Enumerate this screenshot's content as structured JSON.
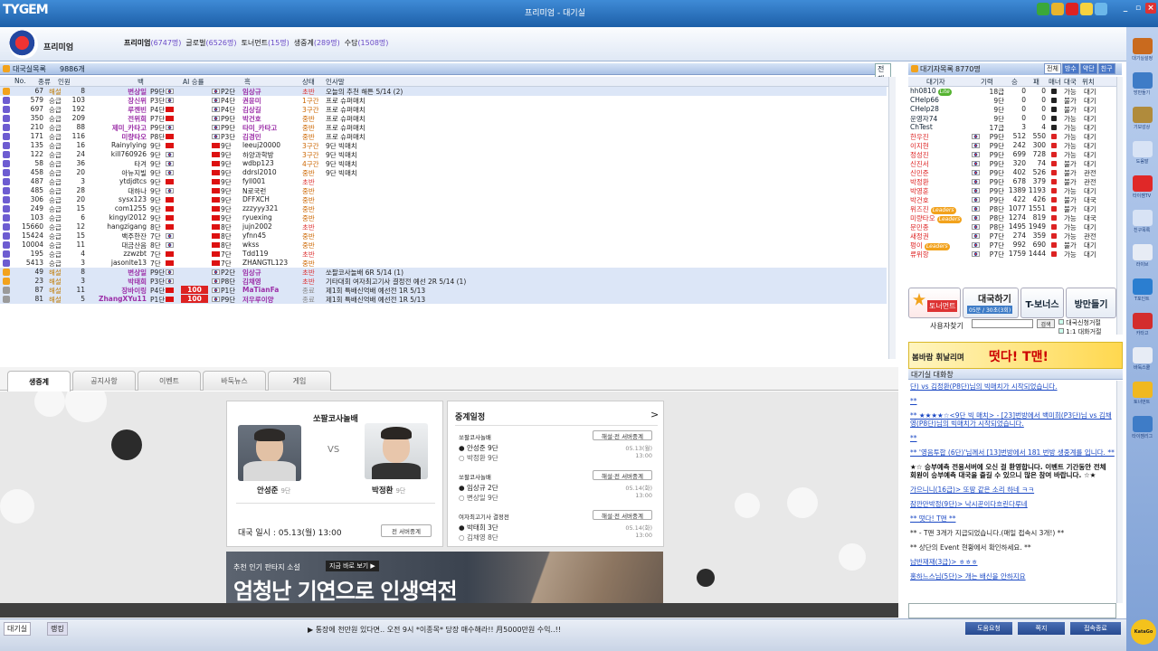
{
  "app": {
    "logo": "TYGEM",
    "center_title": "프리미엄 - 대기실",
    "win_controls": [
      "_",
      "▫",
      "×"
    ]
  },
  "right_bar": [
    {
      "label": "대기실설정",
      "color": "#c96a1e"
    },
    {
      "label": "방만들기",
      "color": "#3e7cc7"
    },
    {
      "label": "기보감상",
      "color": "#b08b3c"
    },
    {
      "label": "도움말",
      "color": "#d8e3f5"
    },
    {
      "label": "타이젬TV",
      "color": "#e02828"
    },
    {
      "label": "친구목록",
      "color": "#d8e3f5"
    },
    {
      "label": "라이브",
      "color": "#e7ecf5"
    },
    {
      "label": "T포인트",
      "color": "#2b7ed0"
    },
    {
      "label": "카타고",
      "color": "#d32d2d"
    },
    {
      "label": "바둑스쿨",
      "color": "#e7ecf5"
    },
    {
      "label": "토너먼트",
      "color": "#f0b820"
    },
    {
      "label": "타이젬리그",
      "color": "#3e7cc7"
    }
  ],
  "room_header": {
    "title": "프리미엄",
    "tabs_text": "프리미엄",
    "tabs": [
      {
        "name": "프리미엄",
        "count": "(6747명)"
      },
      {
        "name": "글로벌",
        "count": "(6526명)"
      },
      {
        "name": "토너먼트",
        "count": "(15명)"
      },
      {
        "name": "생중계",
        "count": "(289명)"
      },
      {
        "name": "수담",
        "count": "(1508명)"
      }
    ]
  },
  "room_list": {
    "title": "대국실목록",
    "count": "9886개",
    "filter": "전체",
    "columns": [
      "No.",
      "종류",
      "인원",
      "백",
      "AI 승률",
      "흑",
      "상태",
      "인사말"
    ],
    "rows": [
      {
        "icon": "y",
        "no": "67",
        "type": "해설",
        "people": "8",
        "white": "변상일",
        "wrank": "P9단",
        "wf": "k",
        "ai": "",
        "brank": "P2단",
        "black": "임상규",
        "state": "초반",
        "msg": "오늘의 추천 해튼 5/14 (2)",
        "sel": true
      },
      {
        "icon": "p",
        "no": "579",
        "type": "승급",
        "people": "103",
        "white": "장신위",
        "wrank": "P3단",
        "wf": "k",
        "ai": "",
        "brank": "P4단",
        "black": "권윤미",
        "state": "1구간",
        "msg": "프로 슈퍼매치",
        "sel": false
      },
      {
        "icon": "p",
        "no": "697",
        "type": "승급",
        "people": "192",
        "white": "루젠빈",
        "wrank": "P4단",
        "wf": "c",
        "ai": "",
        "brank": "P4단",
        "black": "김상길",
        "state": "3구간",
        "msg": "프로 슈퍼매치",
        "sel": false
      },
      {
        "icon": "p",
        "no": "350",
        "type": "승급",
        "people": "209",
        "white": "전위희",
        "wrank": "P7단",
        "wf": "c",
        "ai": "",
        "brank": "P9단",
        "black": "박건호",
        "state": "중반",
        "msg": "프로 슈퍼매치",
        "sel": false
      },
      {
        "icon": "p",
        "no": "210",
        "type": "승급",
        "people": "88",
        "white": "제미_카타고",
        "wrank": "P9단",
        "wf": "k",
        "ai": "",
        "brank": "P9단",
        "black": "타미_카타고",
        "state": "중반",
        "msg": "프로 슈퍼매치",
        "sel": false
      },
      {
        "icon": "p",
        "no": "171",
        "type": "승급",
        "people": "116",
        "white": "미량타오",
        "wrank": "P8단",
        "wf": "c",
        "ai": "",
        "brank": "P3단",
        "black": "김경민",
        "state": "중반",
        "msg": "프로 슈퍼매치",
        "sel": false
      },
      {
        "icon": "p",
        "no": "135",
        "type": "승급",
        "people": "16",
        "white": "Rainylying",
        "wrank": "9단",
        "wf": "c",
        "ai": "",
        "brank": "9단",
        "black": "leeuj20000",
        "state": "3구간",
        "msg": "9단 빅매치",
        "sel": false
      },
      {
        "icon": "p",
        "no": "122",
        "type": "승급",
        "people": "24",
        "white": "kill760926",
        "wrank": "9단",
        "wf": "k",
        "ai": "",
        "brank": "9단",
        "black": "하양과학방",
        "state": "3구간",
        "msg": "9단 빅매치",
        "sel": false
      },
      {
        "icon": "p",
        "no": "58",
        "type": "승급",
        "people": "36",
        "white": "타겨",
        "wrank": "9단",
        "wf": "k",
        "ai": "",
        "brank": "9단",
        "black": "wdbp123",
        "state": "4구간",
        "msg": "9단 빅매치",
        "sel": false
      },
      {
        "icon": "p",
        "no": "458",
        "type": "승급",
        "people": "20",
        "white": "아뉴지빌",
        "wrank": "9단",
        "wf": "k",
        "ai": "",
        "brank": "9단",
        "black": "ddrsl2010",
        "state": "중반",
        "msg": "9단 빅매치",
        "sel": false
      },
      {
        "icon": "p",
        "no": "487",
        "type": "승급",
        "people": "3",
        "white": "ytdjdtcs",
        "wrank": "9단",
        "wf": "c",
        "ai": "",
        "brank": "9단",
        "black": "fyll001",
        "state": "초반",
        "msg": "",
        "sel": false
      },
      {
        "icon": "p",
        "no": "485",
        "type": "승급",
        "people": "28",
        "white": "대하나",
        "wrank": "9단",
        "wf": "k",
        "ai": "",
        "brank": "9단",
        "black": "N로국런",
        "state": "중반",
        "msg": "",
        "sel": false
      },
      {
        "icon": "p",
        "no": "306",
        "type": "승급",
        "people": "20",
        "white": "sysx123",
        "wrank": "9단",
        "wf": "c",
        "ai": "",
        "brank": "9단",
        "black": "DFFXCH",
        "state": "중반",
        "msg": "",
        "sel": false
      },
      {
        "icon": "p",
        "no": "249",
        "type": "승급",
        "people": "15",
        "white": "com1255",
        "wrank": "9단",
        "wf": "c",
        "ai": "",
        "brank": "9단",
        "black": "zzzyyy321",
        "state": "중반",
        "msg": "",
        "sel": false
      },
      {
        "icon": "p",
        "no": "103",
        "type": "승급",
        "people": "6",
        "white": "kingyl2012",
        "wrank": "9단",
        "wf": "c",
        "ai": "",
        "brank": "9단",
        "black": "ryuexing",
        "state": "중반",
        "msg": "",
        "sel": false
      },
      {
        "icon": "p",
        "no": "15660",
        "type": "승급",
        "people": "12",
        "white": "hangzigang",
        "wrank": "8단",
        "wf": "c",
        "ai": "",
        "brank": "8단",
        "black": "jujn2002",
        "state": "초반",
        "msg": "",
        "sel": false
      },
      {
        "icon": "p",
        "no": "15424",
        "type": "승급",
        "people": "15",
        "white": "백주한잔",
        "wrank": "7단",
        "wf": "k",
        "ai": "",
        "brank": "8단",
        "black": "yfnn45",
        "state": "중반",
        "msg": "",
        "sel": false
      },
      {
        "icon": "p",
        "no": "10004",
        "type": "승급",
        "people": "11",
        "white": "대금산음",
        "wrank": "8단",
        "wf": "k",
        "ai": "",
        "brank": "8단",
        "black": "wkss",
        "state": "중반",
        "msg": "",
        "sel": false
      },
      {
        "icon": "p",
        "no": "195",
        "type": "승급",
        "people": "4",
        "white": "zzwzbt",
        "wrank": "7단",
        "wf": "c",
        "ai": "",
        "brank": "7단",
        "black": "Tdd119",
        "state": "초반",
        "msg": "",
        "sel": false
      },
      {
        "icon": "p",
        "no": "5413",
        "type": "승급",
        "people": "3",
        "white": "jasonlte13",
        "wrank": "7단",
        "wf": "c",
        "ai": "",
        "brank": "7단",
        "black": "ZHANGTL123",
        "state": "중반",
        "msg": "",
        "sel": false
      },
      {
        "icon": "y",
        "no": "49",
        "type": "해설",
        "people": "8",
        "white": "변상일",
        "wrank": "P9단",
        "wf": "k",
        "ai": "",
        "brank": "P2단",
        "black": "임상규",
        "state": "초반",
        "msg": "쏘팔코사놀배 6R 5/14 (1)",
        "sel": true
      },
      {
        "icon": "y",
        "no": "23",
        "type": "해설",
        "people": "3",
        "white": "박태희",
        "wrank": "P3단",
        "wf": "k",
        "ai": "",
        "brank": "P8단",
        "black": "김채영",
        "state": "초반",
        "msg": "기타대회 여자최고기사 결정전 예선 2R 5/14 (1)",
        "sel": true
      },
      {
        "icon": "g",
        "no": "87",
        "type": "해설",
        "people": "11",
        "white": "장바이링",
        "wrank": "P4단",
        "wf": "c",
        "ai": "100",
        "brank": "P1단",
        "black": "MaTianFa",
        "state": "종료",
        "msg": "제1회 특배신억배 예선전 1R 5/13",
        "sel": true
      },
      {
        "icon": "g",
        "no": "81",
        "type": "해설",
        "people": "5",
        "white": "ZhangXYu11",
        "wrank": "P1단",
        "wf": "c",
        "ai": "100",
        "brank": "P9단",
        "black": "저우루이양",
        "state": "종료",
        "msg": "제1회 특배신억배 예선전 1R 5/13",
        "sel": true
      }
    ]
  },
  "tabs": [
    "생중계",
    "공지사항",
    "이벤트",
    "바둑뉴스",
    "게임"
  ],
  "match_card": {
    "title": "쏘팔코사놀배",
    "vs": "VS",
    "white_name": "안성준",
    "white_rank": "9단",
    "black_name": "박정환",
    "black_rank": "9단",
    "time_label": "대국 일시 : 05.13(월) 13:00",
    "button": "전 서버중계"
  },
  "schedule": {
    "title": "중계일정",
    "arrow": ">",
    "items": [
      {
        "event": "쏘팔코사놀배",
        "btn": "해설·전 서버중계",
        "b": "안성준 9단",
        "w": "박정환 9단",
        "date": "05.13(월)",
        "time": "13:00"
      },
      {
        "event": "쏘팔코사놀배",
        "btn": "해설·전 서버중계",
        "b": "임상규 2단",
        "w": "변상일 9단",
        "date": "05.14(화)",
        "time": "13:00"
      },
      {
        "event": "여자최고기사 결정전",
        "btn": "해설·전 서버중계",
        "b": "박태희 3단",
        "w": "김채영 8단",
        "date": "05.14(화)",
        "time": "13:00"
      }
    ]
  },
  "banner": {
    "small": "추천 인기 판타지 소설",
    "btn": "지금 바로 보기 ▶",
    "big": "엄청난 기연으로 인생역전"
  },
  "waiting": {
    "title": "대기자목록",
    "count": "8770명",
    "filters": [
      "전체",
      "방수",
      "약단",
      "친구"
    ],
    "columns": [
      "대기자",
      "기력",
      "승",
      "패",
      "매너",
      "대국",
      "위치"
    ],
    "rows": [
      {
        "name": "hh0810",
        "badge": "green",
        "bl": "Lite",
        "rank": "18급",
        "w": "0",
        "l": "0",
        "m": "k",
        "st": "가능",
        "loc": "대기"
      },
      {
        "name": "CHelp66",
        "badge": "",
        "bl": "",
        "rank": "9단",
        "w": "0",
        "l": "0",
        "m": "k",
        "st": "불가",
        "loc": "대기"
      },
      {
        "name": "CHelp28",
        "badge": "",
        "bl": "",
        "rank": "9단",
        "w": "0",
        "l": "0",
        "m": "k",
        "st": "불가",
        "loc": "대기"
      },
      {
        "name": "운영자74",
        "badge": "",
        "bl": "",
        "rank": "9단",
        "w": "0",
        "l": "0",
        "m": "k",
        "st": "가능",
        "loc": "대기"
      },
      {
        "name": "ChTest",
        "badge": "",
        "bl": "",
        "rank": "17급",
        "w": "3",
        "l": "4",
        "m": "k",
        "st": "가능",
        "loc": "대기"
      },
      {
        "name": "한우진",
        "badge": "",
        "bl": "",
        "rank": "P9단",
        "w": "512",
        "l": "550",
        "m": "r",
        "st": "가능",
        "loc": "대기"
      },
      {
        "name": "이지현",
        "badge": "",
        "bl": "",
        "rank": "P9단",
        "w": "242",
        "l": "300",
        "m": "r",
        "st": "가능",
        "loc": "대기"
      },
      {
        "name": "정성진",
        "badge": "",
        "bl": "",
        "rank": "P9단",
        "w": "699",
        "l": "728",
        "m": "r",
        "st": "가능",
        "loc": "대기"
      },
      {
        "name": "신진서",
        "badge": "",
        "bl": "",
        "rank": "P9단",
        "w": "320",
        "l": "74",
        "m": "r",
        "st": "불가",
        "loc": "대기"
      },
      {
        "name": "신민준",
        "badge": "",
        "bl": "",
        "rank": "P9단",
        "w": "402",
        "l": "526",
        "m": "r",
        "st": "불가",
        "loc": "관전"
      },
      {
        "name": "박정환",
        "badge": "",
        "bl": "",
        "rank": "P9단",
        "w": "678",
        "l": "379",
        "m": "r",
        "st": "불가",
        "loc": "관전"
      },
      {
        "name": "박영훈",
        "badge": "",
        "bl": "",
        "rank": "P9단",
        "w": "1389",
        "l": "1193",
        "m": "r",
        "st": "가능",
        "loc": "대기"
      },
      {
        "name": "박건호",
        "badge": "",
        "bl": "",
        "rank": "P9단",
        "w": "422",
        "l": "426",
        "m": "r",
        "st": "불가",
        "loc": "대국"
      },
      {
        "name": "위즈진",
        "badge": "orange",
        "bl": "Leaders",
        "rank": "P8단",
        "w": "1077",
        "l": "1551",
        "m": "r",
        "st": "불가",
        "loc": "대기"
      },
      {
        "name": "미량타오",
        "badge": "orange",
        "bl": "Leaders",
        "rank": "P8단",
        "w": "1274",
        "l": "819",
        "m": "r",
        "st": "가능",
        "loc": "대국"
      },
      {
        "name": "문민종",
        "badge": "",
        "bl": "",
        "rank": "P8단",
        "w": "1495",
        "l": "1949",
        "m": "r",
        "st": "가능",
        "loc": "대기"
      },
      {
        "name": "새정권",
        "badge": "",
        "bl": "",
        "rank": "P7단",
        "w": "274",
        "l": "359",
        "m": "r",
        "st": "가능",
        "loc": "관전"
      },
      {
        "name": "펑이",
        "badge": "orange",
        "bl": "Leaders",
        "rank": "P7단",
        "w": "992",
        "l": "690",
        "m": "r",
        "st": "불가",
        "loc": "대기"
      },
      {
        "name": "류위항",
        "badge": "",
        "bl": "",
        "rank": "P7단",
        "w": "1759",
        "l": "1444",
        "m": "r",
        "st": "가능",
        "loc": "대기"
      }
    ]
  },
  "promos": {
    "tournament": "토너먼트",
    "match_big": "대국하기",
    "match_sub": "05분 / 30초(3회)",
    "tbonus": "T-보너스",
    "create": "방만들기"
  },
  "userfind": {
    "label": "사용자찾기",
    "search_btn": "검색",
    "opt1": "대국신청거절",
    "opt2": "1:1 대화거절"
  },
  "chat_banner": {
    "left": "봄바람 휘날리며",
    "right": "떳다! T맨!"
  },
  "chat": {
    "title": "대기실 대화창",
    "lines": [
      {
        "t": "단) vs 김정환(P8단)님의 빅매치가 시작되었습니다.",
        "c": "blue"
      },
      {
        "t": "**",
        "c": "blue"
      },
      {
        "t": "** ★★★★☆<9단 빅 매치> - [23]번방에서 백미희(P3단)님 vs 김채영(P8단)님의 빅매치가 시작되었습니다.",
        "c": "blue"
      },
      {
        "t": "**",
        "c": "blue"
      },
      {
        "t": "** '영음투합 (6단)'님께서 [13]번방에서 181 번방 생중계를 입니다. **",
        "c": "blue"
      },
      {
        "t": "★☆ 승부예측 전용서버에 오신 걸 환영합니다. 이벤트 기간동안 전체 회원이 승부예측 대국을 즐길 수 있으니 많은 참여 바랍니다. ☆★",
        "c": "bold"
      },
      {
        "t": "가으니니(16급)> 또땅 같은 소리 하네 ㅋㅋ",
        "c": "blue"
      },
      {
        "t": "잠깐만박정(9단)> 낙시꾼이다흐린다루네",
        "c": "blue"
      },
      {
        "t": "** 떳다! T맨 **",
        "c": "blue"
      },
      {
        "t": "** - T맨 3개가 지급되었습니다.(매일 접속시 3개!) **",
        "c": "plain"
      },
      {
        "t": "** 상단의 Event 현황에서 확인하세요. **",
        "c": "plain"
      },
      {
        "t": "남반재재(3급)> ㅎㅎㅎ",
        "c": "blue"
      },
      {
        "t": "홍하느스님(5단)> 개는 배신을 안하지요",
        "c": "blue"
      }
    ]
  },
  "status": {
    "tab1": "대기실",
    "tab2": "랭킹",
    "ticker": "▶ 통장에 천만원 있다면.. 오전 9시 *이종목* 당장 매수해라!! 月5000만원 수익..!!",
    "buttons": [
      "도움요청",
      "쪽지",
      "접속종료"
    ],
    "kata": "KataGo"
  }
}
